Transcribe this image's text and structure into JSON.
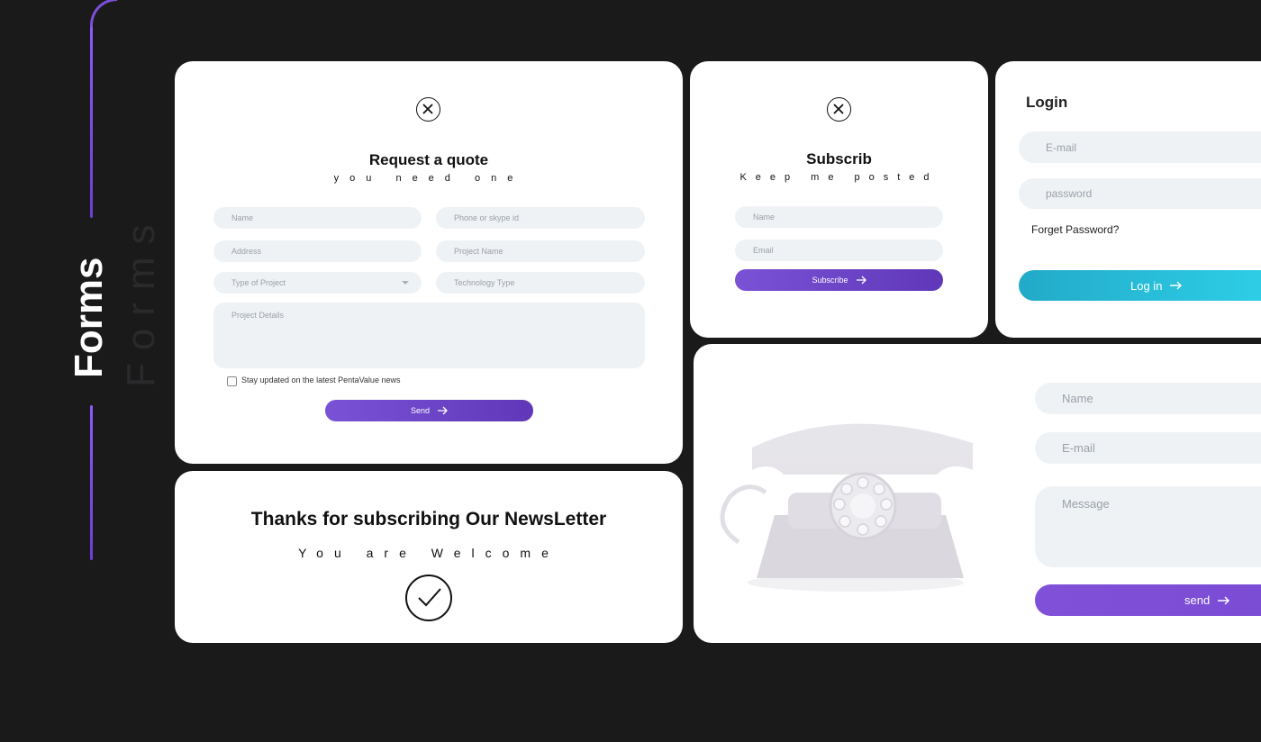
{
  "sidebar": {
    "title": "Forms",
    "ghost_title": "Forms"
  },
  "quote": {
    "title": "Request a quote",
    "subtitle": "you need one",
    "name_placeholder": "Name",
    "phone_placeholder": "Phone or skype id",
    "address_placeholder": "Address",
    "project_name_placeholder": "Project Name",
    "project_type_placeholder": "Type of Project",
    "technology_placeholder": "Technology Type",
    "details_placeholder": "Project Details",
    "checkbox_label": "Stay updated on the latest PentaValue news",
    "send_label": "Send"
  },
  "subscribe": {
    "title": "Subscrib",
    "subtitle": "Keep me posted",
    "name_placeholder": "Name",
    "email_placeholder": "Email",
    "button_label": "Subscribe"
  },
  "login": {
    "title": "Login",
    "email_placeholder": "E-mail",
    "password_placeholder": "password",
    "forgot_label": "Forget Password?",
    "button_label": "Log in"
  },
  "thanks": {
    "title": "Thanks for subscribing Our NewsLetter",
    "subtitle": "You are Welcome"
  },
  "contact": {
    "name_placeholder": "Name",
    "email_placeholder": "E-mail",
    "message_placeholder": "Message",
    "send_label": "send"
  },
  "colors": {
    "background": "#1a1a1b",
    "accent_purple": "#6d42c9",
    "accent_cyan": "#26c0da",
    "field_bg": "#eff2f5"
  }
}
